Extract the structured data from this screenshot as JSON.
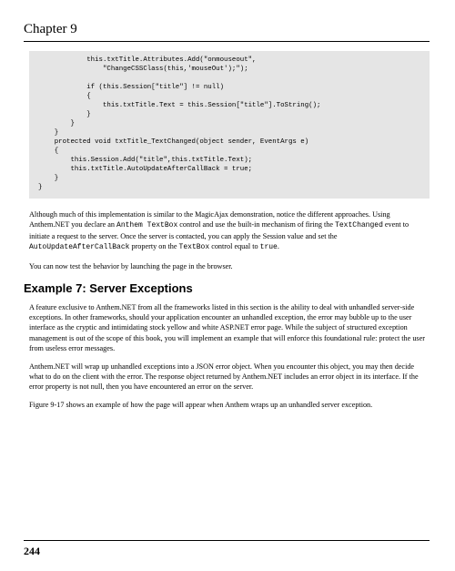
{
  "chapter": "Chapter 9",
  "code": "            this.txtTitle.Attributes.Add(\"onmouseout\",\n                \"ChangeCSSClass(this,'mouseOut');\");\n\n            if (this.Session[\"title\"] != null)\n            {\n                this.txtTitle.Text = this.Session[\"title\"].ToString();\n            }\n        }\n    }\n    protected void txtTitle_TextChanged(object sender, EventArgs e)\n    {\n        this.Session.Add(\"title\",this.txtTitle.Text);\n        this.txtTitle.AutoUpdateAfterCallBack = true;\n    }\n}",
  "p1a": "Although much of this implementation is similar to the MagicAjax demonstration, notice the different approaches. Using Anthem.NET you declare an ",
  "c1": "Anthem TextBox",
  "p1b": " control and use the built-in mechanism of firing the ",
  "c2": "TextChanged",
  "p1c": " event to initiate a request to the server. Once the server is contacted, you can apply the Session value and set the ",
  "c3": "AutoUpdateAfterCallBack",
  "p1d": " property on the ",
  "c4": "TextBox",
  "p1e": " control equal to ",
  "c5": "true",
  "p1f": ".",
  "p2": "You can now test the behavior by launching the page in the browser.",
  "exampleHeading": "Example 7: Server Exceptions",
  "p3": "A feature exclusive to Anthem.NET from all the frameworks listed in this section is the ability to deal with unhandled server-side exceptions. In other frameworks, should your application encounter an unhandled exception, the error may bubble up to the user interface as the cryptic and intimidating stock yellow and white ASP.NET error page. While the subject of structured exception management is out of the scope of this book, you will implement an example that will enforce this foundational rule: protect the user from useless error messages.",
  "p4": "Anthem.NET will wrap up unhandled exceptions into a JSON error object. When you encounter this object, you may then decide what to do on the client with the error. The response object returned by Anthem.NET includes an error object in its interface. If the error property is not null, then you have encountered an error on the server.",
  "p5": "Figure 9-17 shows an example of how the page will appear when Anthem wraps up an unhandled server exception.",
  "pageNumber": "244"
}
